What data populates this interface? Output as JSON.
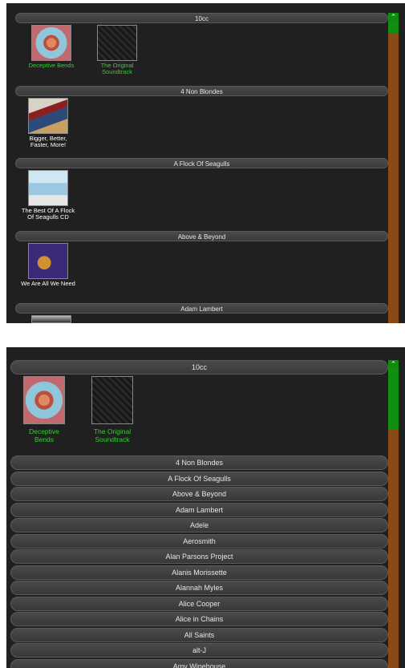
{
  "panel1": {
    "scroll_up_icon": "chevron-up-icon",
    "groups": [
      {
        "artist": "10cc",
        "albums": [
          {
            "title_line1": "Deceptive Bends",
            "title_line2": "",
            "color": "#2bd52b"
          },
          {
            "title_line1": "The Original",
            "title_line2": "Soundtrack",
            "color": "#2bd52b"
          }
        ]
      },
      {
        "artist": "4 Non Blondes",
        "albums": [
          {
            "title_line1": "Bigger, Better,",
            "title_line2": "Faster, More!",
            "color": "#ffffff"
          }
        ]
      },
      {
        "artist": "A Flock Of Seagulls",
        "albums": [
          {
            "title_line1": "The Best Of A Flock",
            "title_line2": "Of Seagulls CD",
            "color": "#ffffff"
          }
        ]
      },
      {
        "artist": "Above & Beyond",
        "albums": [
          {
            "title_line1": "We Are All We Need",
            "title_line2": "",
            "color": "#ffffff"
          }
        ]
      },
      {
        "artist": "Adam Lambert",
        "albums": []
      }
    ]
  },
  "panel2": {
    "scroll_up_icon": "chevron-up-icon",
    "expanded": {
      "artist": "10cc",
      "albums": [
        {
          "title_line1": "Deceptive Bends",
          "title_line2": "",
          "color": "#2bd52b"
        },
        {
          "title_line1": "The Original",
          "title_line2": "Soundtrack",
          "color": "#2bd52b"
        }
      ]
    },
    "artists": [
      "4 Non Blondes",
      "A Flock Of Seagulls",
      "Above & Beyond",
      "Adam Lambert",
      "Adele",
      "Aerosmith",
      "Alan Parsons Project",
      "Alanis Morissette",
      "Alannah Myles",
      "Alice Cooper",
      "Alice in Chains",
      "All Saints",
      "alt-J",
      "Amy Winehouse"
    ]
  },
  "colors": {
    "background": "#202020",
    "accent_green": "#2bd52b",
    "scroll_track": "#8a4a14"
  }
}
